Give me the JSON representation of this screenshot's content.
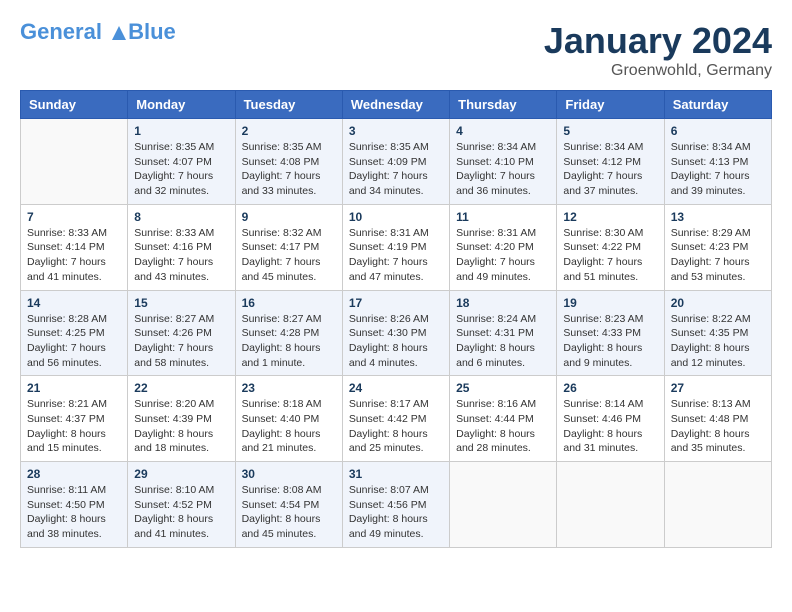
{
  "header": {
    "logo_line1": "General",
    "logo_line2": "Blue",
    "title": "January 2024",
    "subtitle": "Groenwohld, Germany"
  },
  "calendar": {
    "days_of_week": [
      "Sunday",
      "Monday",
      "Tuesday",
      "Wednesday",
      "Thursday",
      "Friday",
      "Saturday"
    ],
    "weeks": [
      [
        {
          "day": "",
          "info": ""
        },
        {
          "day": "1",
          "info": "Sunrise: 8:35 AM\nSunset: 4:07 PM\nDaylight: 7 hours\nand 32 minutes."
        },
        {
          "day": "2",
          "info": "Sunrise: 8:35 AM\nSunset: 4:08 PM\nDaylight: 7 hours\nand 33 minutes."
        },
        {
          "day": "3",
          "info": "Sunrise: 8:35 AM\nSunset: 4:09 PM\nDaylight: 7 hours\nand 34 minutes."
        },
        {
          "day": "4",
          "info": "Sunrise: 8:34 AM\nSunset: 4:10 PM\nDaylight: 7 hours\nand 36 minutes."
        },
        {
          "day": "5",
          "info": "Sunrise: 8:34 AM\nSunset: 4:12 PM\nDaylight: 7 hours\nand 37 minutes."
        },
        {
          "day": "6",
          "info": "Sunrise: 8:34 AM\nSunset: 4:13 PM\nDaylight: 7 hours\nand 39 minutes."
        }
      ],
      [
        {
          "day": "7",
          "info": "Sunrise: 8:33 AM\nSunset: 4:14 PM\nDaylight: 7 hours\nand 41 minutes."
        },
        {
          "day": "8",
          "info": "Sunrise: 8:33 AM\nSunset: 4:16 PM\nDaylight: 7 hours\nand 43 minutes."
        },
        {
          "day": "9",
          "info": "Sunrise: 8:32 AM\nSunset: 4:17 PM\nDaylight: 7 hours\nand 45 minutes."
        },
        {
          "day": "10",
          "info": "Sunrise: 8:31 AM\nSunset: 4:19 PM\nDaylight: 7 hours\nand 47 minutes."
        },
        {
          "day": "11",
          "info": "Sunrise: 8:31 AM\nSunset: 4:20 PM\nDaylight: 7 hours\nand 49 minutes."
        },
        {
          "day": "12",
          "info": "Sunrise: 8:30 AM\nSunset: 4:22 PM\nDaylight: 7 hours\nand 51 minutes."
        },
        {
          "day": "13",
          "info": "Sunrise: 8:29 AM\nSunset: 4:23 PM\nDaylight: 7 hours\nand 53 minutes."
        }
      ],
      [
        {
          "day": "14",
          "info": "Sunrise: 8:28 AM\nSunset: 4:25 PM\nDaylight: 7 hours\nand 56 minutes."
        },
        {
          "day": "15",
          "info": "Sunrise: 8:27 AM\nSunset: 4:26 PM\nDaylight: 7 hours\nand 58 minutes."
        },
        {
          "day": "16",
          "info": "Sunrise: 8:27 AM\nSunset: 4:28 PM\nDaylight: 8 hours\nand 1 minute."
        },
        {
          "day": "17",
          "info": "Sunrise: 8:26 AM\nSunset: 4:30 PM\nDaylight: 8 hours\nand 4 minutes."
        },
        {
          "day": "18",
          "info": "Sunrise: 8:24 AM\nSunset: 4:31 PM\nDaylight: 8 hours\nand 6 minutes."
        },
        {
          "day": "19",
          "info": "Sunrise: 8:23 AM\nSunset: 4:33 PM\nDaylight: 8 hours\nand 9 minutes."
        },
        {
          "day": "20",
          "info": "Sunrise: 8:22 AM\nSunset: 4:35 PM\nDaylight: 8 hours\nand 12 minutes."
        }
      ],
      [
        {
          "day": "21",
          "info": "Sunrise: 8:21 AM\nSunset: 4:37 PM\nDaylight: 8 hours\nand 15 minutes."
        },
        {
          "day": "22",
          "info": "Sunrise: 8:20 AM\nSunset: 4:39 PM\nDaylight: 8 hours\nand 18 minutes."
        },
        {
          "day": "23",
          "info": "Sunrise: 8:18 AM\nSunset: 4:40 PM\nDaylight: 8 hours\nand 21 minutes."
        },
        {
          "day": "24",
          "info": "Sunrise: 8:17 AM\nSunset: 4:42 PM\nDaylight: 8 hours\nand 25 minutes."
        },
        {
          "day": "25",
          "info": "Sunrise: 8:16 AM\nSunset: 4:44 PM\nDaylight: 8 hours\nand 28 minutes."
        },
        {
          "day": "26",
          "info": "Sunrise: 8:14 AM\nSunset: 4:46 PM\nDaylight: 8 hours\nand 31 minutes."
        },
        {
          "day": "27",
          "info": "Sunrise: 8:13 AM\nSunset: 4:48 PM\nDaylight: 8 hours\nand 35 minutes."
        }
      ],
      [
        {
          "day": "28",
          "info": "Sunrise: 8:11 AM\nSunset: 4:50 PM\nDaylight: 8 hours\nand 38 minutes."
        },
        {
          "day": "29",
          "info": "Sunrise: 8:10 AM\nSunset: 4:52 PM\nDaylight: 8 hours\nand 41 minutes."
        },
        {
          "day": "30",
          "info": "Sunrise: 8:08 AM\nSunset: 4:54 PM\nDaylight: 8 hours\nand 45 minutes."
        },
        {
          "day": "31",
          "info": "Sunrise: 8:07 AM\nSunset: 4:56 PM\nDaylight: 8 hours\nand 49 minutes."
        },
        {
          "day": "",
          "info": ""
        },
        {
          "day": "",
          "info": ""
        },
        {
          "day": "",
          "info": ""
        }
      ]
    ]
  }
}
